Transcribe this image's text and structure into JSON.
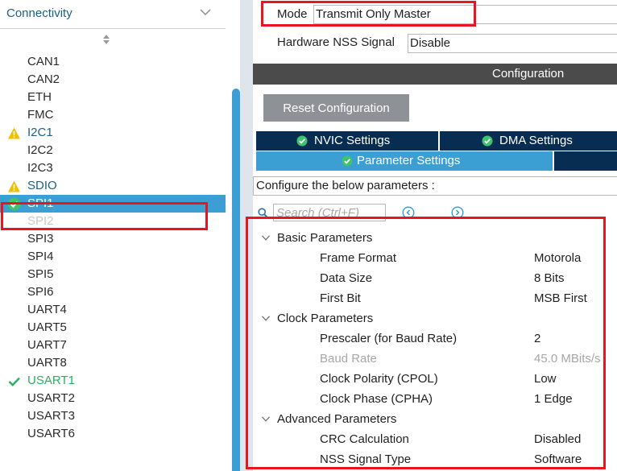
{
  "left_panel": {
    "category_title": "Connectivity",
    "items": [
      {
        "label": "CAN1",
        "status": "none"
      },
      {
        "label": "CAN2",
        "status": "none"
      },
      {
        "label": "ETH",
        "status": "none"
      },
      {
        "label": "FMC",
        "status": "none"
      },
      {
        "label": "I2C1",
        "status": "warning"
      },
      {
        "label": "I2C2",
        "status": "none"
      },
      {
        "label": "I2C3",
        "status": "none"
      },
      {
        "label": "SDIO",
        "status": "warning"
      },
      {
        "label": "SPI1",
        "status": "selected"
      },
      {
        "label": "SPI2",
        "status": "faded"
      },
      {
        "label": "SPI3",
        "status": "none"
      },
      {
        "label": "SPI4",
        "status": "none"
      },
      {
        "label": "SPI5",
        "status": "none"
      },
      {
        "label": "SPI6",
        "status": "none"
      },
      {
        "label": "UART4",
        "status": "none"
      },
      {
        "label": "UART5",
        "status": "none"
      },
      {
        "label": "UART7",
        "status": "none"
      },
      {
        "label": "UART8",
        "status": "none"
      },
      {
        "label": "USART1",
        "status": "ok"
      },
      {
        "label": "USART2",
        "status": "none"
      },
      {
        "label": "USART3",
        "status": "none"
      },
      {
        "label": "USART6",
        "status": "none"
      }
    ]
  },
  "mode_panel": {
    "mode_label": "Mode",
    "mode_value": "Transmit Only Master",
    "nss_label": "Hardware NSS Signal",
    "nss_value": "Disable"
  },
  "configuration": {
    "title": "Configuration",
    "reset_button": "Reset Configuration",
    "tabs": {
      "nvic": "NVIC Settings",
      "dma": "DMA Settings",
      "parameter": "Parameter Settings"
    },
    "configure_text": "Configure the below parameters :",
    "search_placeholder": "Search (Ctrl+F)"
  },
  "parameters": {
    "groups": [
      {
        "name": "Basic Parameters",
        "rows": [
          {
            "name": "Frame Format",
            "value": "Motorola",
            "disabled": false
          },
          {
            "name": "Data Size",
            "value": "8 Bits",
            "disabled": false
          },
          {
            "name": "First Bit",
            "value": "MSB First",
            "disabled": false
          }
        ]
      },
      {
        "name": "Clock Parameters",
        "rows": [
          {
            "name": "Prescaler (for Baud Rate)",
            "value": "2",
            "disabled": false
          },
          {
            "name": "Baud Rate",
            "value": "45.0 MBits/s",
            "disabled": true
          },
          {
            "name": "Clock Polarity (CPOL)",
            "value": "Low",
            "disabled": false
          },
          {
            "name": "Clock Phase (CPHA)",
            "value": "1 Edge",
            "disabled": false
          }
        ]
      },
      {
        "name": "Advanced Parameters",
        "rows": [
          {
            "name": "CRC Calculation",
            "value": "Disabled",
            "disabled": false
          },
          {
            "name": "NSS Signal Type",
            "value": "Software",
            "disabled": false
          }
        ]
      }
    ]
  },
  "colors": {
    "accent": "#3b9fd4",
    "dark_tab": "#072d52",
    "highlight": "#e8141e",
    "warning": "#f0c000",
    "ok": "#27ae60"
  }
}
